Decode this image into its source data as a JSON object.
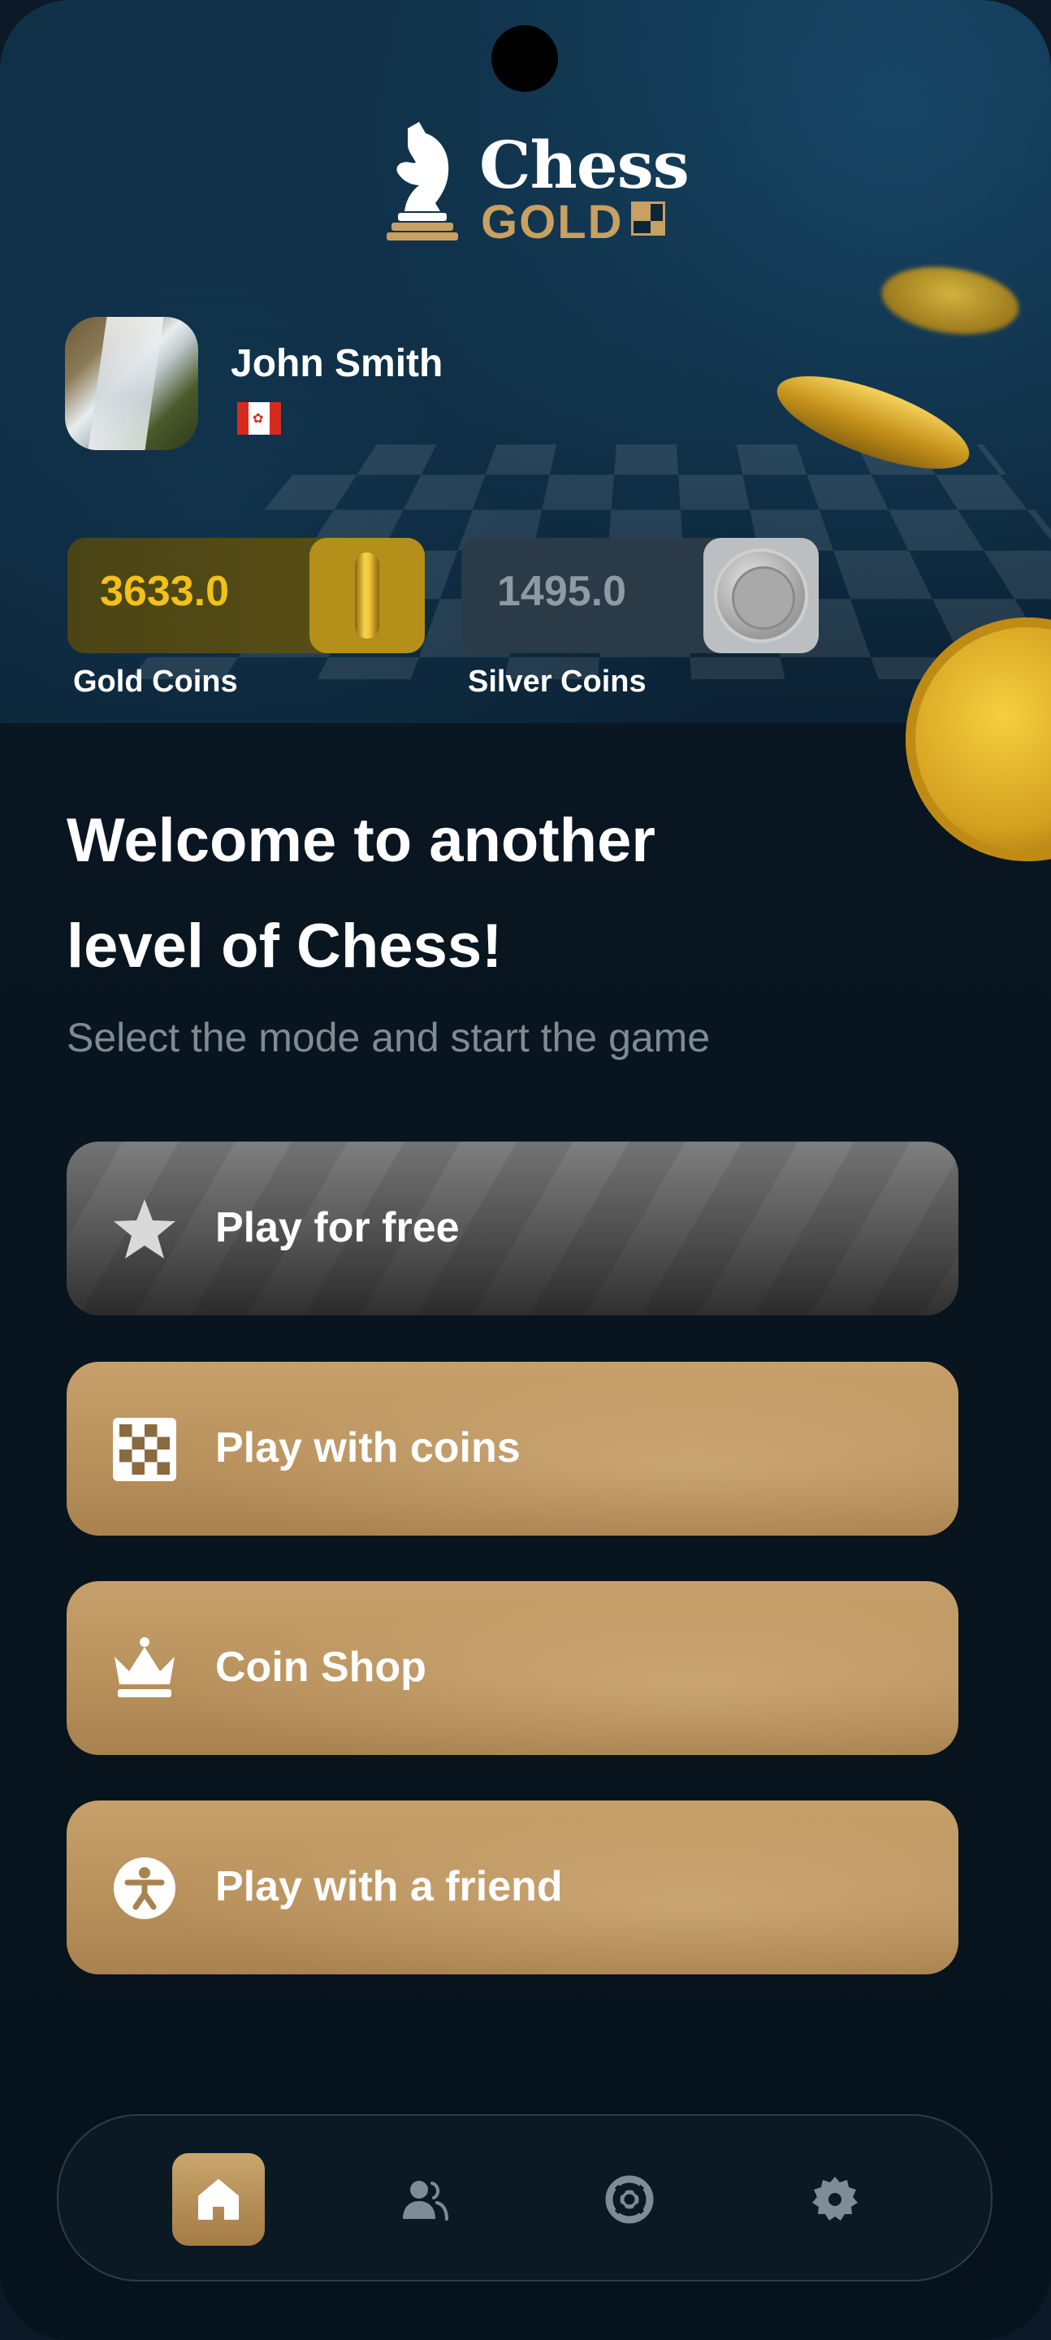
{
  "app": {
    "logo_word": "Chess",
    "logo_sub": "GOLD"
  },
  "profile": {
    "name": "John Smith",
    "flag": "canada-flag"
  },
  "coins": {
    "gold_value": "3633.0",
    "gold_label": "Gold Coins",
    "silver_value": "1495.0",
    "silver_label": "Silver Coins"
  },
  "main": {
    "welcome": "Welcome to another level of Chess!",
    "subtitle": "Select the mode and start the game",
    "buttons": [
      {
        "label": "Play for free",
        "icon": "star-icon"
      },
      {
        "label": "Play with coins",
        "icon": "checkerboard-icon"
      },
      {
        "label": "Coin Shop",
        "icon": "crown-icon"
      },
      {
        "label": "Play with a friend",
        "icon": "person-icon"
      }
    ]
  },
  "nav": {
    "items": [
      {
        "icon": "home-icon",
        "active": true
      },
      {
        "icon": "friends-icon",
        "active": false
      },
      {
        "icon": "lifebuoy-icon",
        "active": false
      },
      {
        "icon": "gear-icon",
        "active": false
      }
    ]
  },
  "colors": {
    "gold_text": "#f2c21a",
    "accent_gold": "#c8a061",
    "silver_text": "#8e9ba4",
    "background": "#0b1a26"
  }
}
